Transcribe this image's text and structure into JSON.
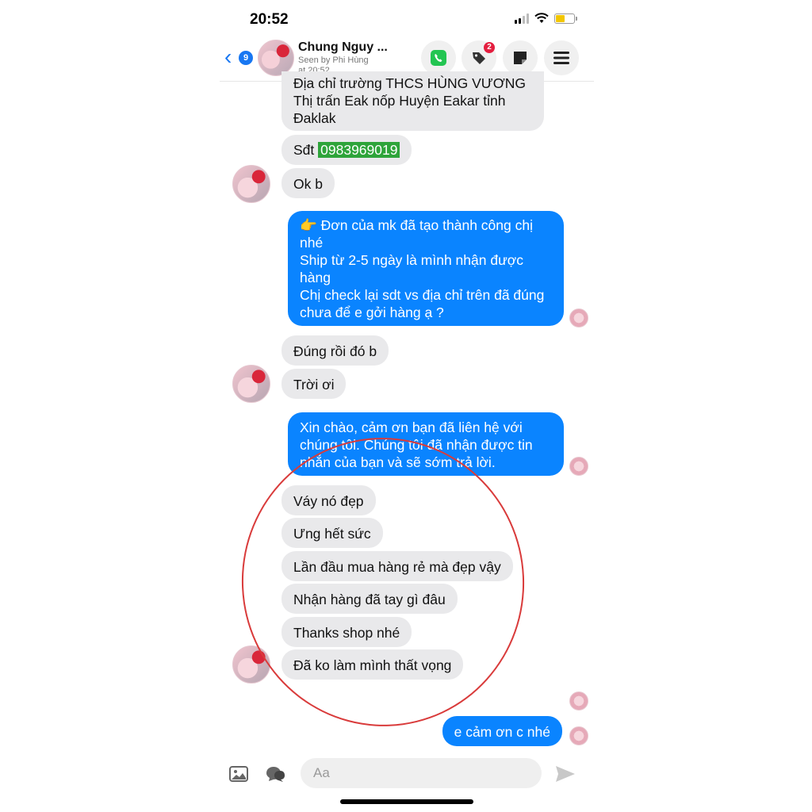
{
  "status": {
    "time": "20:52"
  },
  "header": {
    "back_count": "9",
    "contact_name": "Chung Nguy ...",
    "seen_line1": "Seen by Phi Hùng",
    "seen_line2": "at 20:52",
    "tags_badge": "2"
  },
  "messages": {
    "m1_line1": "Địa chỉ trường THCS HÙNG VƯƠNG",
    "m1_line2": "Thị trấn Eak nốp Huyện Eakar tỉnh",
    "m1_line3": "Đaklak",
    "m2_prefix": "Sđt ",
    "m2_phone": "0983969019",
    "m3": "Ok b",
    "m4_emoji": "👉",
    "m4_line1": " Đơn của mk đã tạo thành công chị nhé",
    "m4_line2": "Ship từ 2-5 ngày là mình nhận được hàng",
    "m4_line3": "Chị check lại sdt vs địa chỉ trên đã đúng chưa để e gởi hàng ạ ?",
    "m5": "Đúng rồi đó b",
    "m6": "Trời ơi",
    "m7": "Xin chào, cảm ơn bạn đã liên hệ với chúng tôi. Chúng tôi đã nhận được tin nhắn của bạn và sẽ sớm trả lời.",
    "m8": "Váy nó đẹp",
    "m9": "Ưng hết sức",
    "m10": "Lần đầu mua hàng rẻ mà đẹp vậy",
    "m11": "Nhận hàng đã tay gì đâu",
    "m12": "Thanks shop nhé",
    "m13": "Đã ko làm mình thất vọng",
    "m14": "e cảm ơn c nhé"
  },
  "composer": {
    "placeholder": "Aa"
  },
  "colors": {
    "outgoing": "#0a84ff",
    "incoming": "#e9e9eb",
    "accent": "#1877f2",
    "highlight": "#2ea43a",
    "annotation": "#d93b3b"
  },
  "icons": [
    "chevron-left-icon",
    "phone-icon",
    "tag-icon",
    "note-icon",
    "menu-icon",
    "image-icon",
    "sticker-icon",
    "send-icon"
  ]
}
